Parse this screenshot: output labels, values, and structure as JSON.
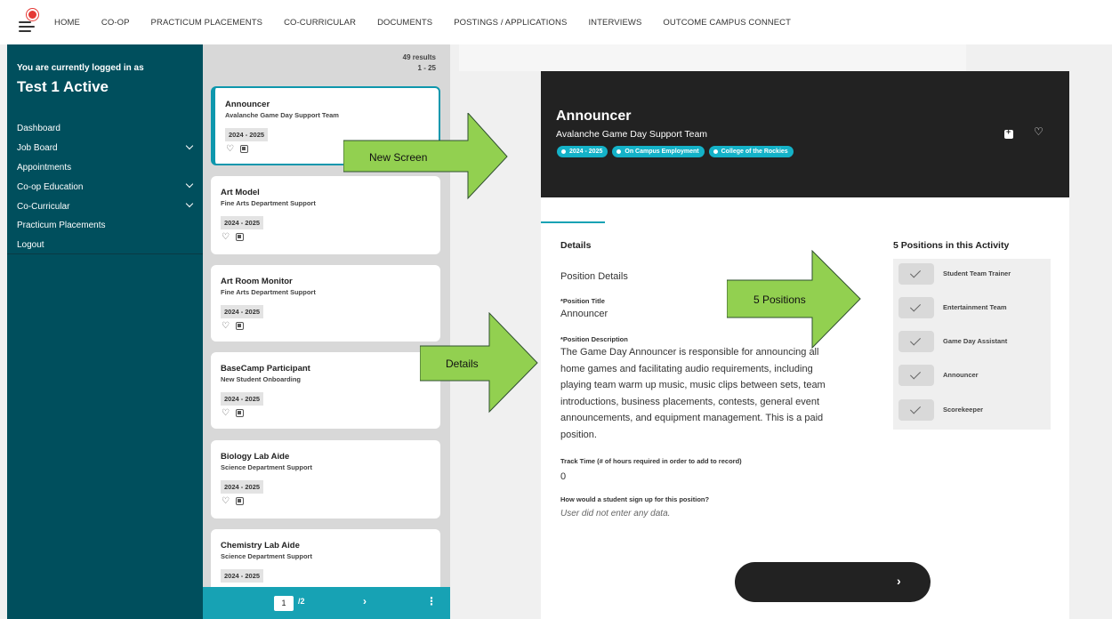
{
  "nav": {
    "links": [
      "HOME",
      "CO-OP",
      "PRACTICUM PLACEMENTS",
      "CO-CURRICULAR",
      "DOCUMENTS",
      "POSTINGS / APPLICATIONS",
      "INTERVIEWS",
      "OUTCOME CAMPUS CONNECT"
    ]
  },
  "sidebar": {
    "logged_in_label": "You are currently logged in as",
    "user_name": "Test 1 Active",
    "items": [
      {
        "label": "Dashboard"
      },
      {
        "label": "Job Board"
      },
      {
        "label": "Appointments"
      },
      {
        "label": "Co-op Education"
      },
      {
        "label": "Co-Curricular"
      },
      {
        "label": "Practicum Placements"
      },
      {
        "label": "Logout"
      }
    ]
  },
  "results": {
    "count": "49 results",
    "range": "1 - 25",
    "cards": [
      {
        "title": "Announcer",
        "subtitle": "Avalanche Game Day Support Team",
        "year": "2024 - 2025"
      },
      {
        "title": "Art Model",
        "subtitle": "Fine Arts Department Support",
        "year": "2024 - 2025"
      },
      {
        "title": "Art Room Monitor",
        "subtitle": "Fine Arts Department Support",
        "year": "2024 - 2025"
      },
      {
        "title": "BaseCamp Participant",
        "subtitle": "New Student Onboarding",
        "year": "2024 - 2025"
      },
      {
        "title": "Biology Lab Aide",
        "subtitle": "Science Department Support",
        "year": "2024 - 2025"
      },
      {
        "title": "Chemistry Lab Aide",
        "subtitle": "Science Department Support",
        "year": "2024 - 2025"
      }
    ],
    "pager": {
      "page": "1",
      "total": "/2",
      "next": "›",
      "more": "⋮"
    }
  },
  "detail": {
    "title": "Announcer",
    "subtitle": "Avalanche Game Day Support Team",
    "tags": [
      "2024 - 2025",
      "On Campus Employment",
      "College of the Rockies"
    ],
    "details_heading": "Details",
    "section": "Position Details",
    "position_title_label": "*Position Title",
    "position_title": "Announcer",
    "description_label": "*Position Description",
    "description": "The Game Day Announcer is responsible for announcing all home games and facilitating audio requirements, including playing team warm up music, music clips between sets, team introductions, business placements, contests, general event announcements, and equipment management. This is a paid position.",
    "track_time_label": "Track Time (# of hours required in order to add to record)",
    "track_time": "0",
    "signup_label": "How would a student sign up for this position?",
    "signup_value": "User did not enter any data.",
    "positions_heading": "5 Positions in this Activity",
    "positions": [
      "Student Team Trainer",
      "Entertainment Team",
      "Game Day Assistant",
      "Announcer",
      "Scorekeeper"
    ],
    "next_label": "›"
  },
  "callouts": {
    "new_screen": "New Screen",
    "details": "Details",
    "positions": "5 Positions"
  },
  "colors": {
    "sidebar": "#004f5d",
    "accent": "#17a2b4",
    "tag": "#14b2c8",
    "header_dark": "#222222",
    "callout_green": "#92d050"
  }
}
